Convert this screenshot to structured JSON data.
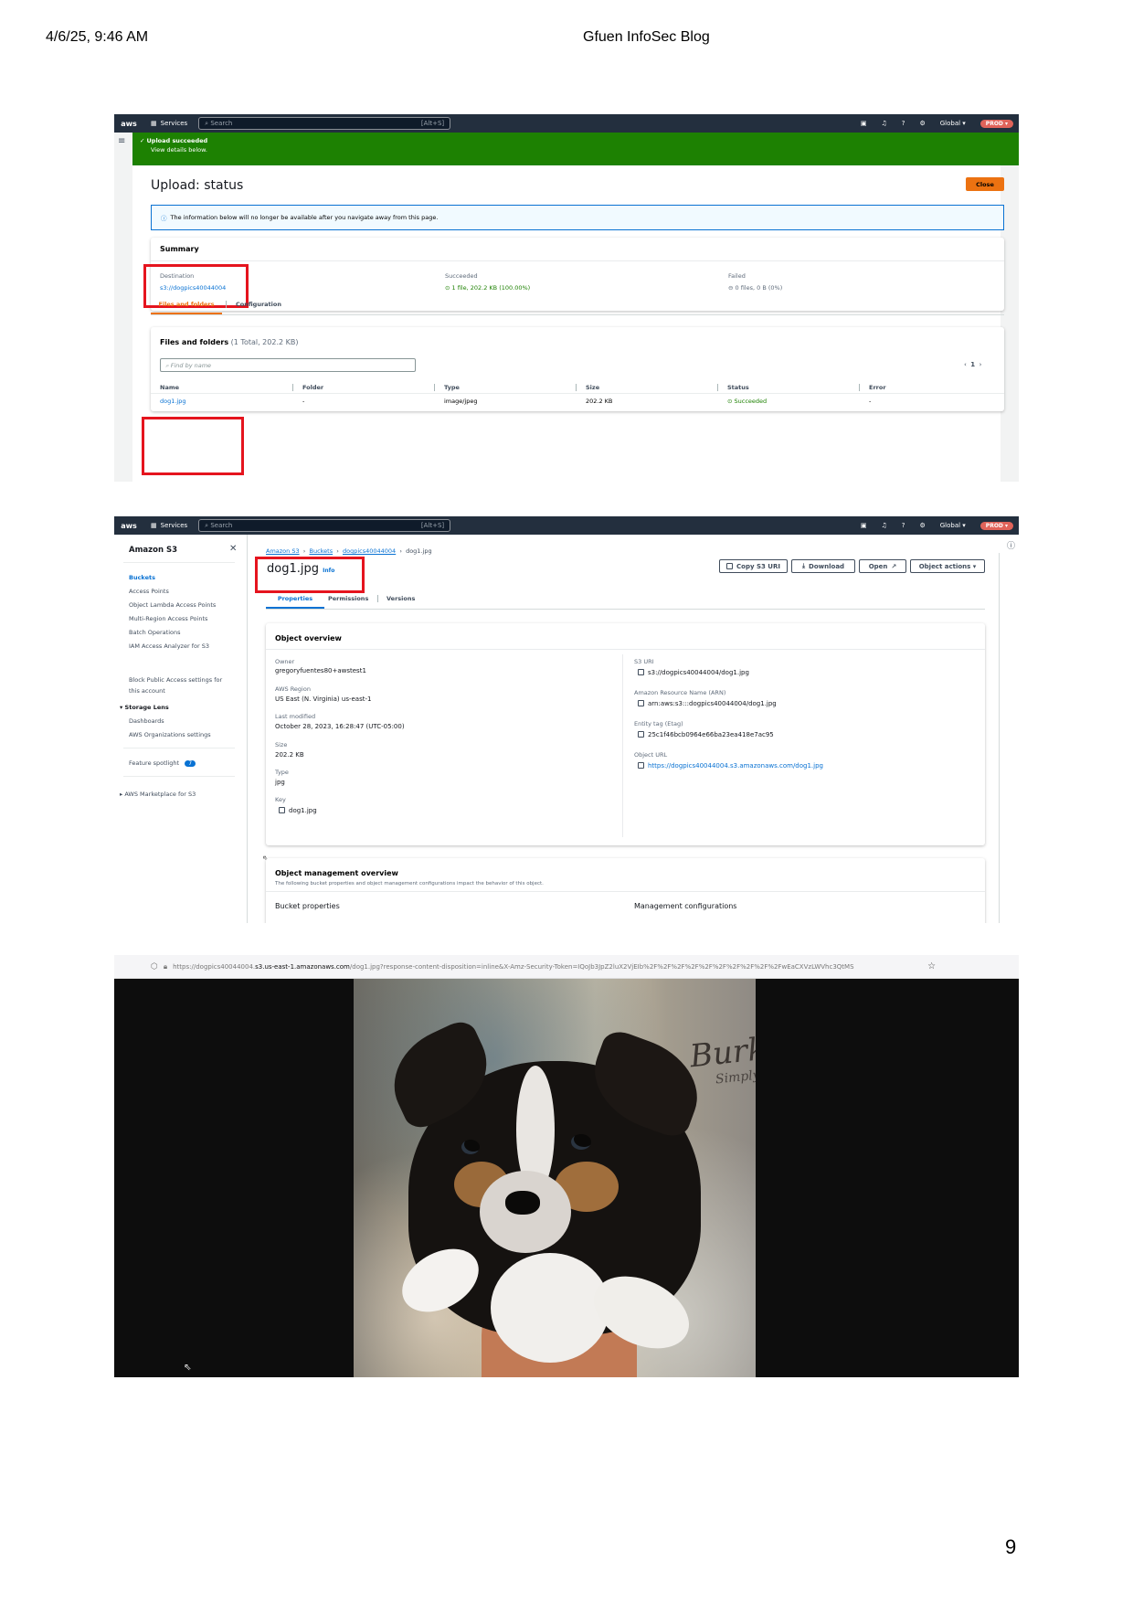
{
  "page_header": {
    "datetime": "4/6/25, 9:46 AM",
    "blog_title": "Gfuen InfoSec Blog",
    "page_number": "9"
  },
  "nav": {
    "logo": "aws",
    "services": "Services",
    "search_placeholder": "Search",
    "search_shortcut": "[Alt+S]",
    "region": "Global ▾",
    "account": "PROD ▾"
  },
  "upload": {
    "banner_title": "Upload succeeded",
    "banner_sub": "View details below.",
    "title": "Upload: status",
    "close": "Close",
    "info": "The information below will no longer be available after you navigate away from this page.",
    "summary_title": "Summary",
    "destination_label": "Destination",
    "destination_value": "s3://dogpics40044004",
    "succeeded_label": "Succeeded",
    "succeeded_value": "1 file, 202.2 KB (100.00%)",
    "failed_label": "Failed",
    "failed_value": "0 files, 0 B (0%)",
    "tab_files": "Files and folders",
    "tab_config": "Configuration",
    "files_title": "Files and folders",
    "files_count": "(1 Total, 202.2 KB)",
    "find_placeholder": "Find by name",
    "page": "1",
    "columns": [
      "Name",
      "Folder",
      "Type",
      "Size",
      "Status",
      "Error"
    ],
    "row": {
      "name": "dog1.jpg",
      "folder": "-",
      "type": "image/jpeg",
      "size": "202.2 KB",
      "status": "Succeeded",
      "error": "-"
    }
  },
  "object": {
    "sidebar_title": "Amazon S3",
    "sidebar_items": [
      "Buckets",
      "Access Points",
      "Object Lambda Access Points",
      "Multi-Region Access Points",
      "Batch Operations",
      "IAM Access Analyzer for S3"
    ],
    "sidebar_block_1": "Block Public Access settings for",
    "sidebar_block_2": "this account",
    "storage_lens": "Storage Lens",
    "storage_items": [
      "Dashboards",
      "AWS Organizations settings"
    ],
    "feature_spotlight": "Feature spotlight",
    "feature_count": "7",
    "marketplace": "AWS Marketplace for S3",
    "breadcrumb": [
      "Amazon S3",
      "Buckets",
      "dogpics40044004",
      "dog1.jpg"
    ],
    "title": "dog1.jpg",
    "info": "Info",
    "buttons": {
      "copy_uri": "Copy S3 URI",
      "download": "Download",
      "open": "Open",
      "actions": "Object actions ▾"
    },
    "tabs": [
      "Properties",
      "Permissions",
      "Versions"
    ],
    "overview_title": "Object overview",
    "owner_label": "Owner",
    "owner": "gregoryfuentes80+awstest1",
    "region_label": "AWS Region",
    "region": "US East (N. Virginia) us-east-1",
    "modified_label": "Last modified",
    "modified": "October 28, 2023, 16:28:47 (UTC-05:00)",
    "size_label": "Size",
    "size": "202.2 KB",
    "type_label": "Type",
    "type": "jpg",
    "key_label": "Key",
    "key": "dog1.jpg",
    "uri_label": "S3 URI",
    "uri": "s3://dogpics40044004/dog1.jpg",
    "arn_label": "Amazon Resource Name (ARN)",
    "arn": "arn:aws:s3:::dogpics40044004/dog1.jpg",
    "etag_label": "Entity tag (Etag)",
    "etag": "25c1f46bcb0964e66ba23ea418e7ac95",
    "url_label": "Object URL",
    "url": "https://dogpics40044004.s3.amazonaws.com/dog1.jpg",
    "mgmt_title": "Object management overview",
    "mgmt_desc": "The following bucket properties and object management configurations impact the behavior of this object.",
    "bucket_props": "Bucket properties",
    "mgmt_configs": "Management configurations"
  },
  "browser": {
    "url_prefix": "https://dogpics40044004.",
    "url_host": "s3.us-east-1.amazonaws.com",
    "url_rest": "/dog1.jpg?response-content-disposition=inline&X-Amz-Security-Token=IQoJb3JpZ2luX2VjEIb%2F%2F%2F%2F%2F%2F%2F%2F%2F%2FwEaCXVzLWVhc3QtMS"
  },
  "photo": {
    "sign_text": "Burke",
    "sign_sub": "Simply"
  }
}
